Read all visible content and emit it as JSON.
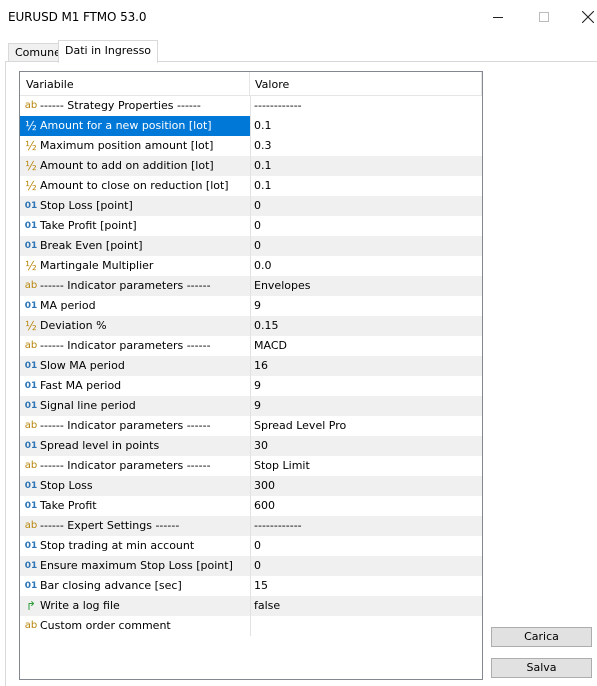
{
  "window": {
    "title": "EURUSD M1 FTMO 53.0"
  },
  "tabs": [
    {
      "label": "Comune",
      "active": false
    },
    {
      "label": "Dati in Ingresso",
      "active": true
    }
  ],
  "grid": {
    "headers": {
      "name": "Variabile",
      "value": "Valore"
    },
    "rows": [
      {
        "icon": "ab",
        "name": "------ Strategy Properties ------",
        "value": "------------"
      },
      {
        "icon": "½",
        "name": "Amount for a new position [lot]",
        "value": "0.1",
        "selected": true
      },
      {
        "icon": "½",
        "name": "Maximum position amount [lot]",
        "value": "0.3"
      },
      {
        "icon": "½",
        "name": "Amount to add on addition [lot]",
        "value": "0.1"
      },
      {
        "icon": "½",
        "name": "Amount to close on reduction [lot]",
        "value": "0.1"
      },
      {
        "icon": "01",
        "name": "Stop Loss [point]",
        "value": "0"
      },
      {
        "icon": "01",
        "name": "Take Profit [point]",
        "value": "0"
      },
      {
        "icon": "01",
        "name": "Break Even [point]",
        "value": "0"
      },
      {
        "icon": "½",
        "name": "Martingale Multiplier",
        "value": "0.0"
      },
      {
        "icon": "ab",
        "name": "------ Indicator parameters ------",
        "value": "Envelopes"
      },
      {
        "icon": "01",
        "name": "MA period",
        "value": "9"
      },
      {
        "icon": "½",
        "name": "Deviation %",
        "value": "0.15"
      },
      {
        "icon": "ab",
        "name": "------ Indicator parameters ------",
        "value": "MACD"
      },
      {
        "icon": "01",
        "name": "Slow MA period",
        "value": "16"
      },
      {
        "icon": "01",
        "name": "Fast MA period",
        "value": "9"
      },
      {
        "icon": "01",
        "name": "Signal line period",
        "value": "9"
      },
      {
        "icon": "ab",
        "name": "------ Indicator parameters ------",
        "value": "Spread Level Pro"
      },
      {
        "icon": "01",
        "name": "Spread level in points",
        "value": "30"
      },
      {
        "icon": "ab",
        "name": "------ Indicator parameters ------",
        "value": "Stop Limit"
      },
      {
        "icon": "01",
        "name": "Stop Loss",
        "value": "300"
      },
      {
        "icon": "01",
        "name": "Take Profit",
        "value": "600"
      },
      {
        "icon": "ab",
        "name": "------ Expert Settings ------",
        "value": "------------"
      },
      {
        "icon": "01",
        "name": "Stop trading at min account",
        "value": "0"
      },
      {
        "icon": "01",
        "name": "Ensure maximum Stop Loss [point]",
        "value": "0"
      },
      {
        "icon": "01",
        "name": "Bar closing advance [sec]",
        "value": "15"
      },
      {
        "icon": "bool",
        "name": "Write a log file",
        "value": "false"
      },
      {
        "icon": "ab",
        "name": "Custom order comment",
        "value": ""
      }
    ]
  },
  "buttons": {
    "load": "Carica",
    "save": "Salva"
  }
}
